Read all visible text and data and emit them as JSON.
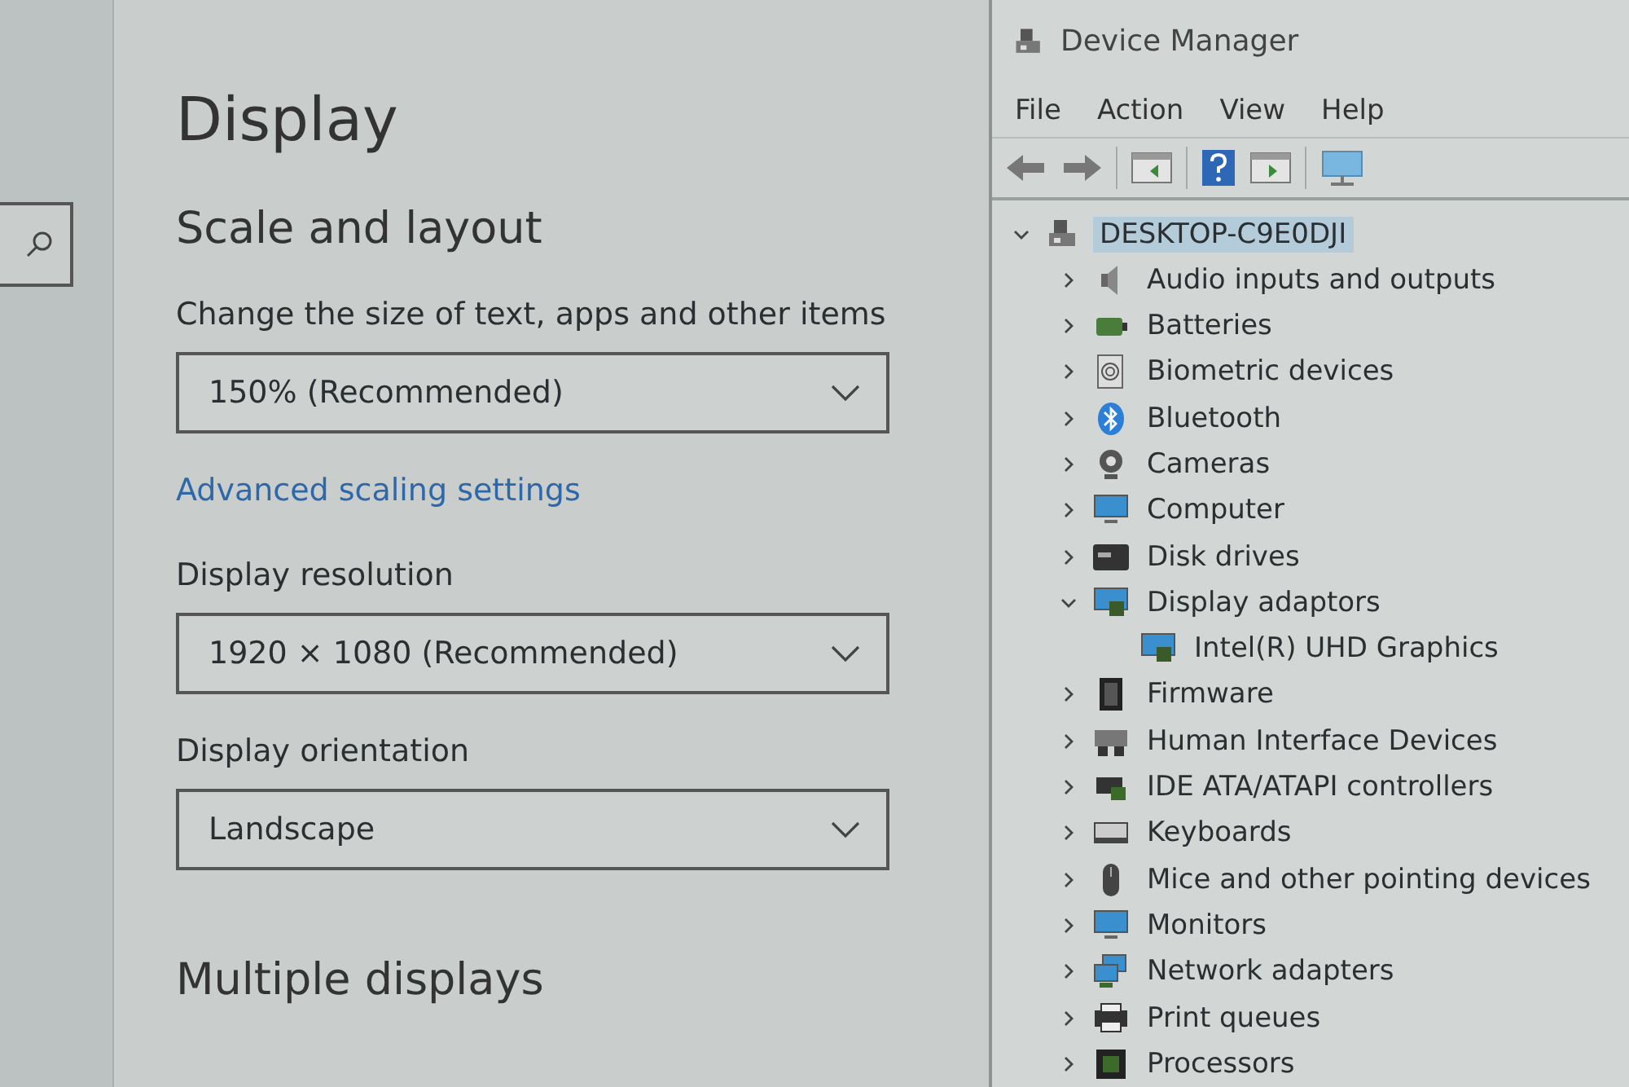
{
  "settings": {
    "title": "Display",
    "sections": [
      {
        "heading": "Scale and layout",
        "fields": [
          {
            "kind": "dropdown",
            "label": "Change the size of text, apps and other items",
            "value": "150% (Recommended)"
          },
          {
            "kind": "link",
            "label": "Advanced scaling settings"
          },
          {
            "kind": "dropdown",
            "label": "Display resolution",
            "value": "1920 × 1080 (Recommended)"
          },
          {
            "kind": "dropdown",
            "label": "Display orientation",
            "value": "Landscape"
          }
        ]
      },
      {
        "heading": "Multiple displays"
      }
    ]
  },
  "device_manager": {
    "window": {
      "title": "Device Manager"
    },
    "menu": [
      "File",
      "Action",
      "View",
      "Help"
    ],
    "tree": [
      {
        "label": "DESKTOP-C9E0DJI",
        "expanded": true,
        "selected": true,
        "children": [
          {
            "label": "Audio inputs and outputs",
            "expanded": false,
            "selected": false
          },
          {
            "label": "Batteries",
            "expanded": false,
            "selected": false
          },
          {
            "label": "Biometric devices",
            "expanded": false,
            "selected": false
          },
          {
            "label": "Bluetooth",
            "expanded": false,
            "selected": false
          },
          {
            "label": "Cameras",
            "expanded": false,
            "selected": false
          },
          {
            "label": "Computer",
            "expanded": false,
            "selected": false
          },
          {
            "label": "Disk drives",
            "expanded": false,
            "selected": false
          },
          {
            "label": "Display adaptors",
            "expanded": true,
            "selected": false,
            "children": [
              {
                "label": "Intel(R) UHD Graphics",
                "selected": false
              }
            ]
          },
          {
            "label": "Firmware",
            "expanded": false,
            "selected": false
          },
          {
            "label": "Human Interface Devices",
            "expanded": false,
            "selected": false
          },
          {
            "label": "IDE ATA/ATAPI controllers",
            "expanded": false,
            "selected": false
          },
          {
            "label": "Keyboards",
            "expanded": false,
            "selected": false
          },
          {
            "label": "Mice and other pointing devices",
            "expanded": false,
            "selected": false
          },
          {
            "label": "Monitors",
            "expanded": false,
            "selected": false
          },
          {
            "label": "Network adapters",
            "expanded": false,
            "selected": false
          },
          {
            "label": "Print queues",
            "expanded": false,
            "selected": false
          },
          {
            "label": "Processors",
            "expanded": false,
            "selected": false
          }
        ]
      }
    ]
  }
}
